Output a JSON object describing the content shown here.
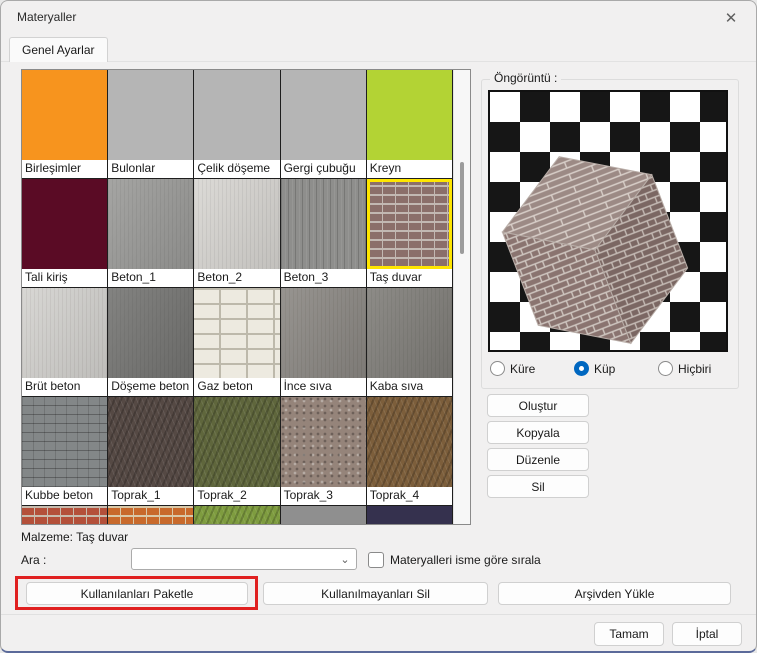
{
  "window": {
    "title": "Materyaller",
    "close_icon": "✕"
  },
  "tabs": [
    {
      "label": "Genel Ayarlar"
    }
  ],
  "materials": {
    "selected_label": "Taş duvar",
    "items": [
      {
        "label": "Birleşimler",
        "color": "#F7941E",
        "pattern": "solid",
        "selected": false
      },
      {
        "label": "Bulonlar",
        "color": "#B5B5B5",
        "pattern": "solid",
        "selected": false
      },
      {
        "label": "Çelik döşeme",
        "color": "#B5B5B5",
        "pattern": "solid",
        "selected": false
      },
      {
        "label": "Gergi çubuğu",
        "color": "#B5B5B5",
        "pattern": "solid",
        "selected": false
      },
      {
        "label": "Kreyn",
        "color": "#B3D334",
        "pattern": "solid",
        "selected": false
      },
      {
        "label": "Tali kiriş",
        "color": "#5A0B25",
        "pattern": "solid",
        "selected": false
      },
      {
        "label": "Beton_1",
        "color": "#9B9B99",
        "pattern": "noise",
        "selected": false
      },
      {
        "label": "Beton_2",
        "color": "#D8D6D2",
        "pattern": "noise",
        "selected": false
      },
      {
        "label": "Beton_3",
        "color": "#8E8E8C",
        "pattern": "vlines",
        "selected": false
      },
      {
        "label": "Taş duvar",
        "color": "#8B6F6A",
        "mortar": "#C2B8B2",
        "pattern": "brick",
        "selected": true
      },
      {
        "label": "Brüt beton",
        "color": "#D4D2CF",
        "pattern": "noise",
        "selected": false
      },
      {
        "label": "Döşeme beton",
        "color": "#757573",
        "pattern": "noise",
        "selected": false
      },
      {
        "label": "Gaz beton",
        "color": "#EDEAE0",
        "mortar": "#BDB9AB",
        "pattern": "blocks",
        "selected": false
      },
      {
        "label": "İnce sıva",
        "color": "#8B8883",
        "pattern": "noise",
        "selected": false
      },
      {
        "label": "Kaba sıva",
        "color": "#807E79",
        "pattern": "noise",
        "selected": false
      },
      {
        "label": "Kubbe beton",
        "color": "#838788",
        "pattern": "rows",
        "selected": false
      },
      {
        "label": "Toprak_1",
        "color": "#554944",
        "pattern": "soil",
        "selected": false
      },
      {
        "label": "Toprak_2",
        "color": "#5F663C",
        "pattern": "soil",
        "selected": false
      },
      {
        "label": "Toprak_3",
        "color": "#95847A",
        "pattern": "pebble",
        "selected": false
      },
      {
        "label": "Toprak_4",
        "color": "#7C5E3B",
        "pattern": "soil",
        "selected": false
      },
      {
        "label": "",
        "color": "#B4503A",
        "mortar": "#C8BCAE",
        "pattern": "brick",
        "selected": false
      },
      {
        "label": "",
        "color": "#C8692B",
        "mortar": "#D9C9A8",
        "pattern": "brick",
        "selected": false
      },
      {
        "label": "",
        "color": "#7E9C3F",
        "pattern": "soil",
        "selected": false
      },
      {
        "label": "",
        "color": "#8F8F8F",
        "pattern": "solid",
        "selected": false
      },
      {
        "label": "",
        "color": "#35314E",
        "pattern": "solid",
        "selected": false
      }
    ]
  },
  "preview": {
    "group_label": "Öngörüntü :",
    "radios": [
      {
        "label": "Küre",
        "selected": false
      },
      {
        "label": "Küp",
        "selected": true
      },
      {
        "label": "Hiçbiri",
        "selected": false
      }
    ]
  },
  "side_buttons": [
    {
      "label": "Oluştur"
    },
    {
      "label": "Kopyala"
    },
    {
      "label": "Düzenle"
    },
    {
      "label": "Sil"
    }
  ],
  "footer_info": {
    "material_label": "Malzeme: Taş duvar",
    "search_label": "Ara :",
    "search_value": "",
    "sort_checkbox_label": "Materyalleri isme göre sırala",
    "sort_checked": false
  },
  "bottom_buttons": [
    {
      "label": "Kullanılanları Paketle",
      "highlighted": true
    },
    {
      "label": "Kullanılmayanları Sil",
      "highlighted": false
    },
    {
      "label": "Arşivden Yükle",
      "highlighted": false
    }
  ],
  "dialog_buttons": [
    {
      "label": "Tamam"
    },
    {
      "label": "İptal"
    }
  ],
  "colors": {
    "radio_accent": "#0067C0",
    "highlight_box": "#E02020",
    "selection_border": "#FFE600"
  }
}
